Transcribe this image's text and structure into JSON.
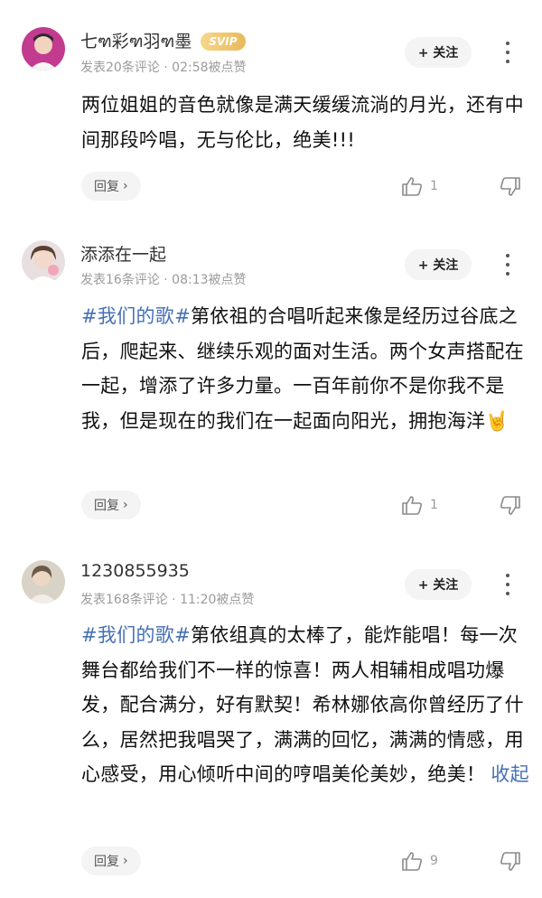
{
  "comments": [
    {
      "name": "七ฑ彩ฑ羽ฑ墨",
      "badge": "SVIP",
      "meta": "发表20条评论 · 02:58被点赞",
      "follow": "+ 关注",
      "tag": "",
      "text": "两位姐姐的音色就像是满天缓缓流淌的月光，还有中间那段吟唱，无与伦比，绝美!!!",
      "fold": "",
      "reply": "回复",
      "likes": "1"
    },
    {
      "name": "添添在一起",
      "badge": "",
      "meta": "发表16条评论 · 08:13被点赞",
      "follow": "+ 关注",
      "tag": "#我们的歌#",
      "text": "第依祖的合唱听起来像是经历过谷底之后，爬起来、继续乐观的面对生活。两个女声搭配在一起，增添了许多力量。一百年前你不是你我不是我，但是现在的我们在一起面向阳光，拥抱海洋🤘",
      "fold": "",
      "reply": "回复",
      "likes": "1"
    },
    {
      "name": "1230855935",
      "badge": "",
      "meta": "发表168条评论 · 11:20被点赞",
      "follow": "+ 关注",
      "tag": "#我们的歌#",
      "text": "第依组真的太棒了，能炸能唱！每一次舞台都给我们不一样的惊喜！两人相辅相成唱功爆发，配合满分，好有默契！希林娜依高你曾经历了什么，居然把我唱哭了，满满的回忆，满满的情感，用心感受，用心倾听中间的哼唱美伦美妙，绝美！",
      "fold": "收起",
      "reply": "回复",
      "likes": "9"
    }
  ]
}
